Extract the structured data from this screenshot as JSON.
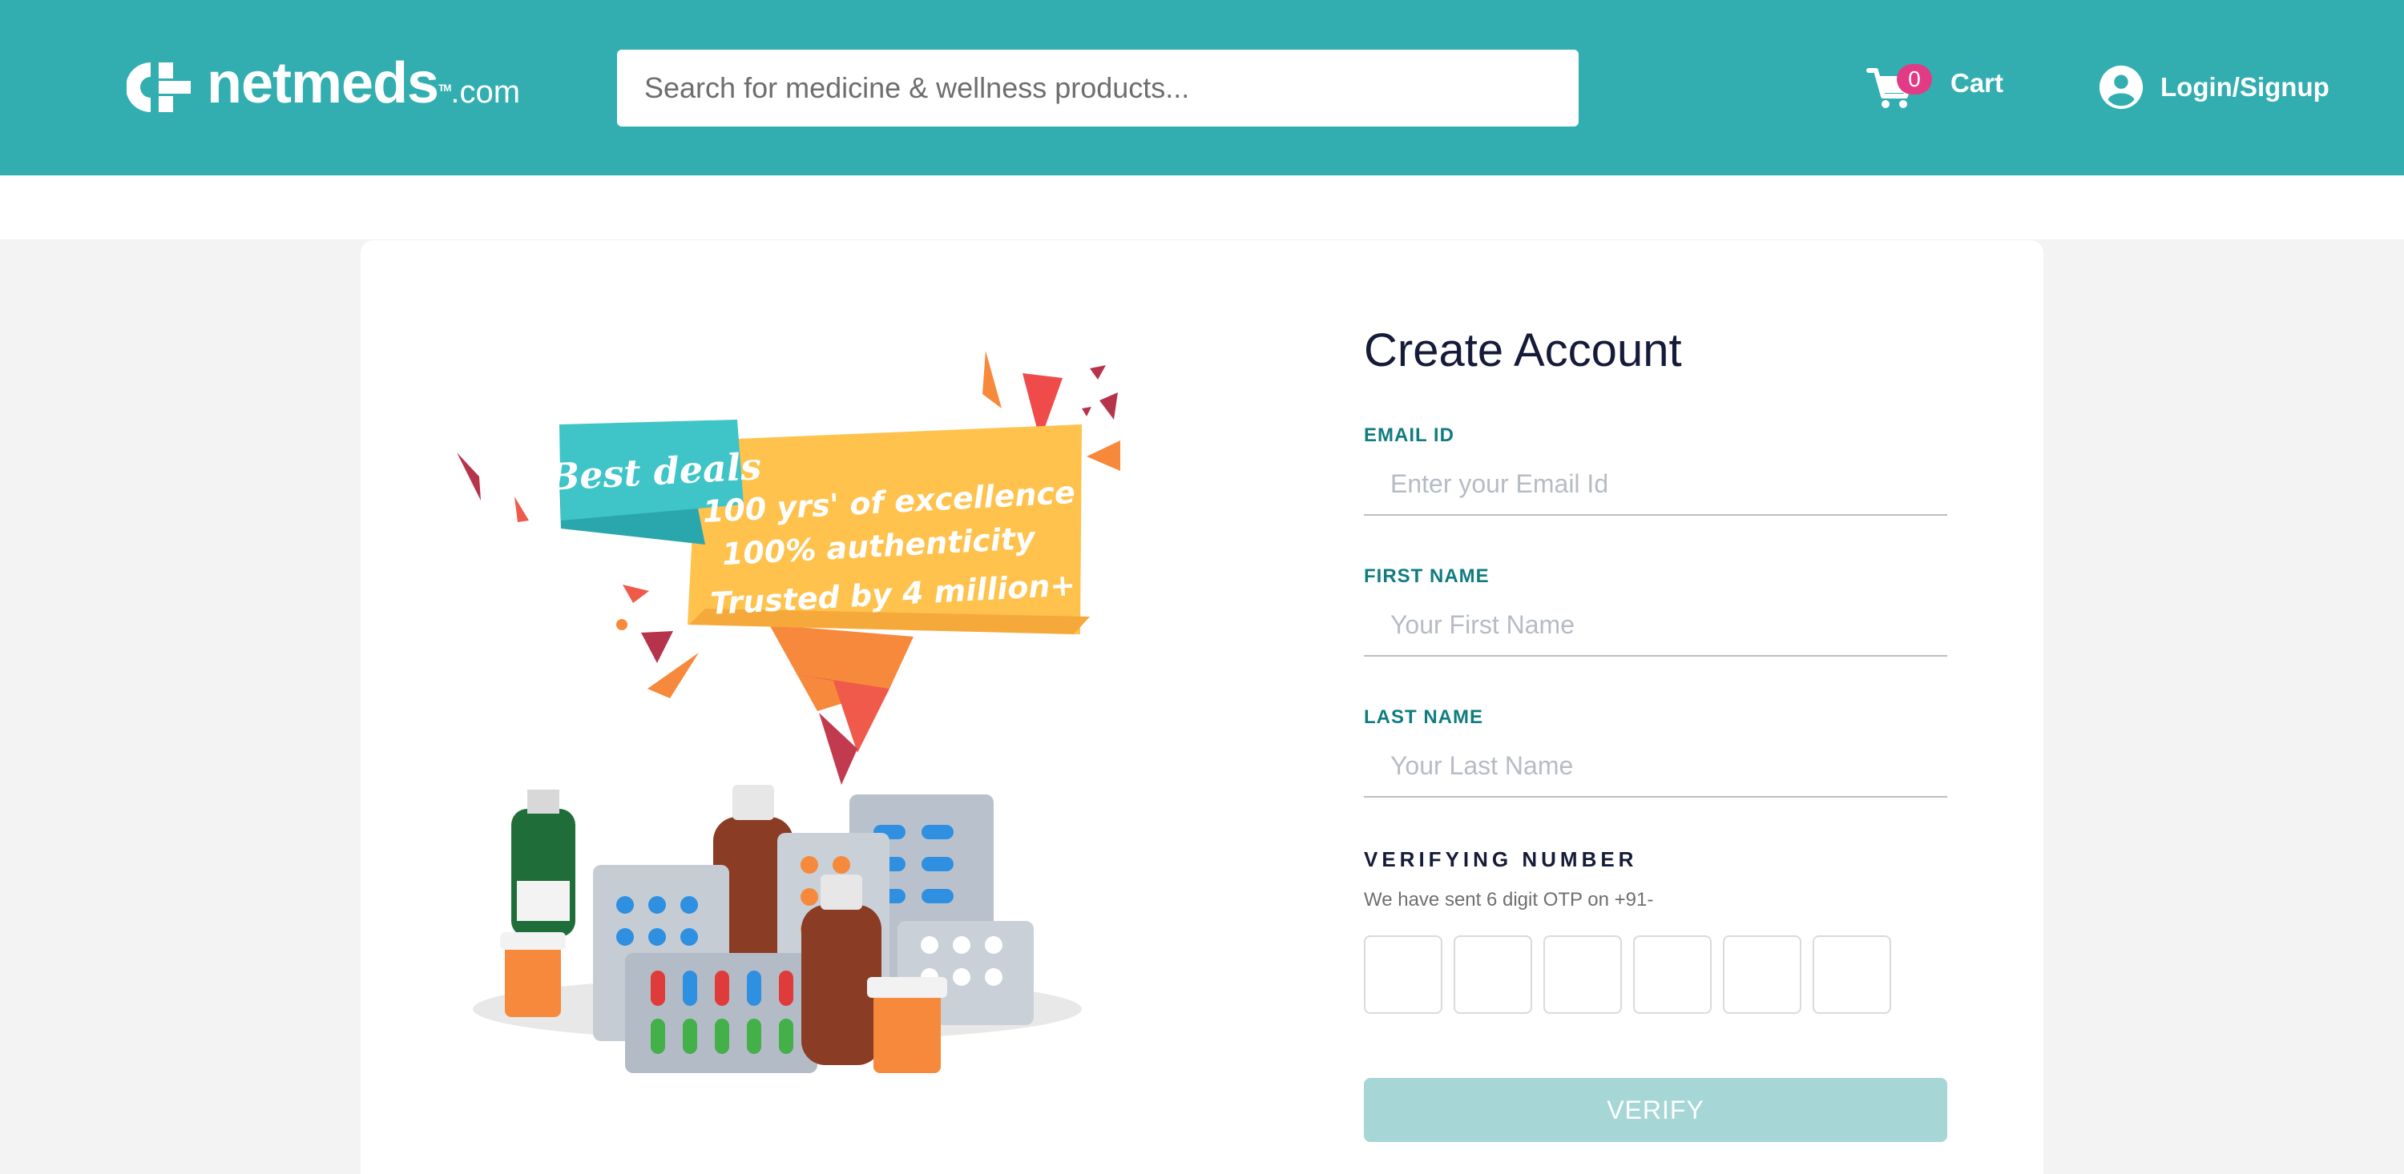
{
  "header": {
    "logo": {
      "name": "netmeds",
      "suffix": ".com",
      "tm": "TM"
    },
    "search": {
      "placeholder": "Search for medicine & wellness products..."
    },
    "cart": {
      "count": "0",
      "label": "Cart"
    },
    "login": {
      "label": "Login/Signup"
    }
  },
  "colors": {
    "brand": "#32aeb1",
    "badge": "#e23a84",
    "field_label": "#107c80",
    "verify_disabled": "#a7d6d7"
  },
  "promo": {
    "badge": "Best deals",
    "lines": [
      "100 yrs' of excellence",
      "100% authenticity",
      "Trusted by 4 million+"
    ]
  },
  "form": {
    "title": "Create Account",
    "email": {
      "label": "EMAIL ID",
      "placeholder": "Enter your Email Id",
      "value": ""
    },
    "first_name": {
      "label": "FIRST NAME",
      "placeholder": "Your First Name",
      "value": ""
    },
    "last_name": {
      "label": "LAST NAME",
      "placeholder": "Your Last Name",
      "value": ""
    },
    "verify_title": "VERIFYING NUMBER",
    "otp_note": "We have sent 6 digit OTP on +91-",
    "otp": [
      "",
      "",
      "",
      "",
      "",
      ""
    ],
    "verify_button": "VERIFY"
  },
  "icons": [
    "netmeds-logo-icon",
    "cart-icon",
    "user-account-icon"
  ]
}
